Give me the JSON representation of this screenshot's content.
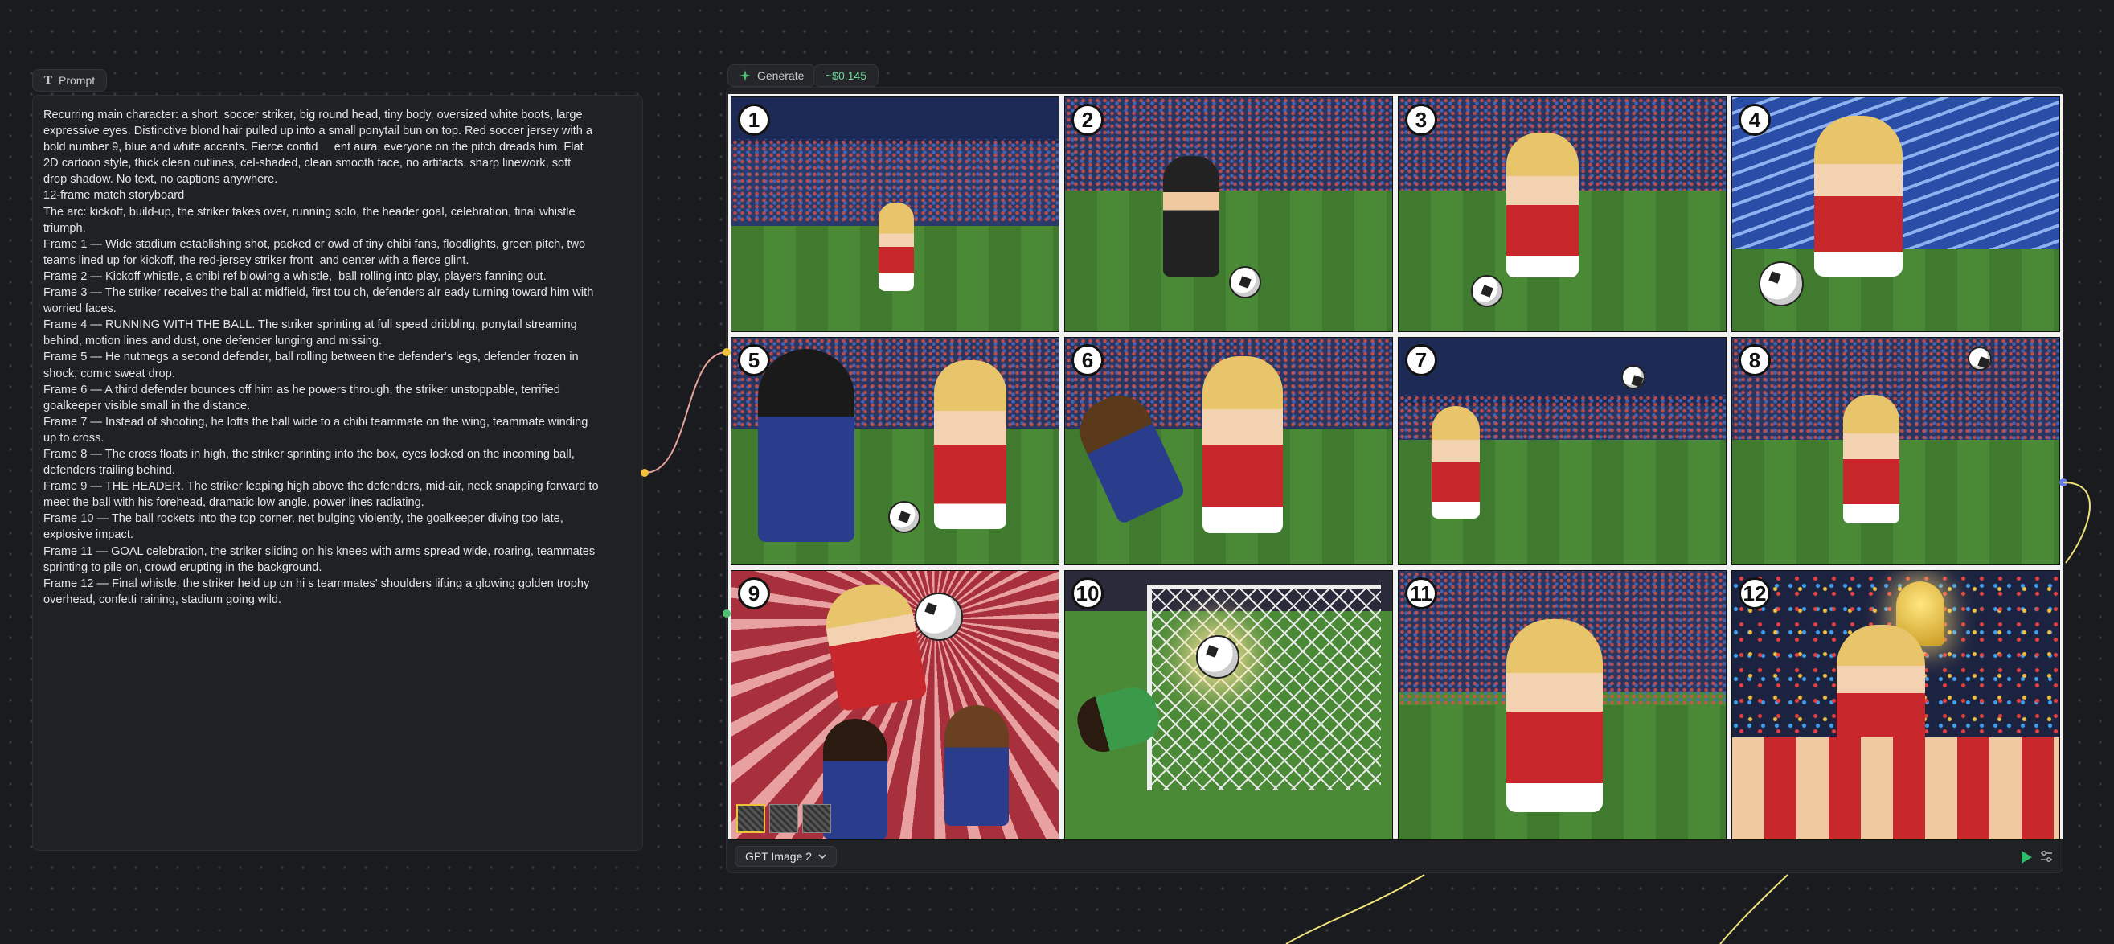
{
  "prompt_node": {
    "tag_label": "Prompt",
    "text": "Recurring main character: a short  soccer striker, big round head, tiny body, oversized white boots, large\nexpressive eyes. Distinctive blond hair pulled up into a small ponytail bun on top. Red soccer jersey with a\nbold number 9, blue and white accents. Fierce confid     ent aura, everyone on the pitch dreads him. Flat\n2D cartoon style, thick clean outlines, cel-shaded, clean smooth face, no artifacts, sharp linework, soft\ndrop shadow. No text, no captions anywhere.\n12-frame match storyboard\nThe arc: kickoff, build-up, the striker takes over, running solo, the header goal, celebration, final whistle\ntriumph.\nFrame 1 — Wide stadium establishing shot, packed cr owd of tiny chibi fans, floodlights, green pitch, two\nteams lined up for kickoff, the red-jersey striker front  and center with a fierce glint.\nFrame 2 — Kickoff whistle, a chibi ref blowing a whistle,  ball rolling into play, players fanning out.\nFrame 3 — The striker receives the ball at midfield, first tou ch, defenders alr eady turning toward him with\nworried faces.\nFrame 4 — RUNNING WITH THE BALL. The striker sprinting at full speed dribbling, ponytail streaming\nbehind, motion lines and dust, one defender lunging and missing.\nFrame 5 — He nutmegs a second defender, ball rolling between the defender's legs, defender frozen in\nshock, comic sweat drop.\nFrame 6 — A third defender bounces off him as he powers through, the striker unstoppable, terrified\ngoalkeeper visible small in the distance.\nFrame 7 — Instead of shooting, he lofts the ball wide to a chibi teammate on the wing, teammate winding\nup to cross.\nFrame 8 — The cross floats in high, the striker sprinting into the box, eyes locked on the incoming ball,\ndefenders trailing behind.\nFrame 9 — THE HEADER. The striker leaping high above the defenders, mid-air, neck snapping forward to\nmeet the ball with his forehead, dramatic low angle, power lines radiating.\nFrame 10 — The ball rockets into the top corner, net bulging violently, the goalkeeper diving too late,\nexplosive impact.\nFrame 11 — GOAL celebration, the striker sliding on his knees with arms spread wide, roaring, teammates\nsprinting to pile on, crowd erupting in the background.\nFrame 12 — Final whistle, the striker held up on hi s teammates' shoulders lifting a glowing golden trophy\noverhead, confetti raining, stadium going wild."
  },
  "generate_node": {
    "generate_label": "Generate",
    "cost_label": "~$0.145",
    "model_label": "GPT Image 2",
    "panels": [
      {
        "num": "1"
      },
      {
        "num": "2"
      },
      {
        "num": "3"
      },
      {
        "num": "4"
      },
      {
        "num": "5"
      },
      {
        "num": "6"
      },
      {
        "num": "7"
      },
      {
        "num": "8"
      },
      {
        "num": "9"
      },
      {
        "num": "10"
      },
      {
        "num": "11"
      },
      {
        "num": "12"
      }
    ]
  },
  "colors": {
    "canvas_bg": "#1a1b1e",
    "node_bg": "#202125",
    "wire_pink": "#e8a39a",
    "wire_yellow": "#f0e27a",
    "port_yellow": "#f0c23a",
    "port_green": "#4fbf72",
    "port_blue": "#6a7ae8",
    "play_green": "#2fbf6a"
  }
}
